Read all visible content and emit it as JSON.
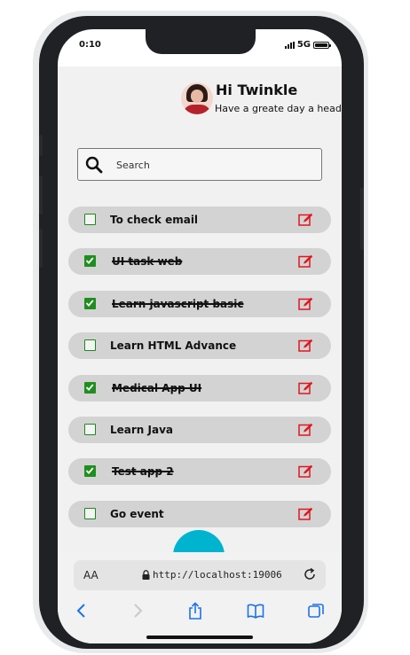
{
  "status_bar": {
    "time": "0:10",
    "network": "5G"
  },
  "header": {
    "greeting": "Hi Twinkle",
    "subtitle": "Have a greate day a head"
  },
  "search": {
    "placeholder": "Search"
  },
  "tasks": [
    {
      "title": "To check email",
      "done": false
    },
    {
      "title": "UI task web",
      "done": true
    },
    {
      "title": "Learn javascript basic",
      "done": true
    },
    {
      "title": "Learn HTML Advance",
      "done": false
    },
    {
      "title": "Medical App UI",
      "done": true
    },
    {
      "title": "Learn Java",
      "done": false
    },
    {
      "title": "Test app 2",
      "done": true
    },
    {
      "title": "Go event",
      "done": false
    }
  ],
  "browser": {
    "text_size_label": "AA",
    "url": "http://localhost:19006"
  },
  "colors": {
    "done_green": "#1e8f1e",
    "edit_red": "#e0161e",
    "fab_cyan": "#00b4d0",
    "task_bg": "#d3d3d3"
  },
  "icons": [
    "search-icon",
    "checkbox-icon",
    "edit-icon",
    "lock-icon",
    "reload-icon",
    "back-icon",
    "forward-icon",
    "share-icon",
    "bookmarks-icon",
    "tabs-icon"
  ]
}
